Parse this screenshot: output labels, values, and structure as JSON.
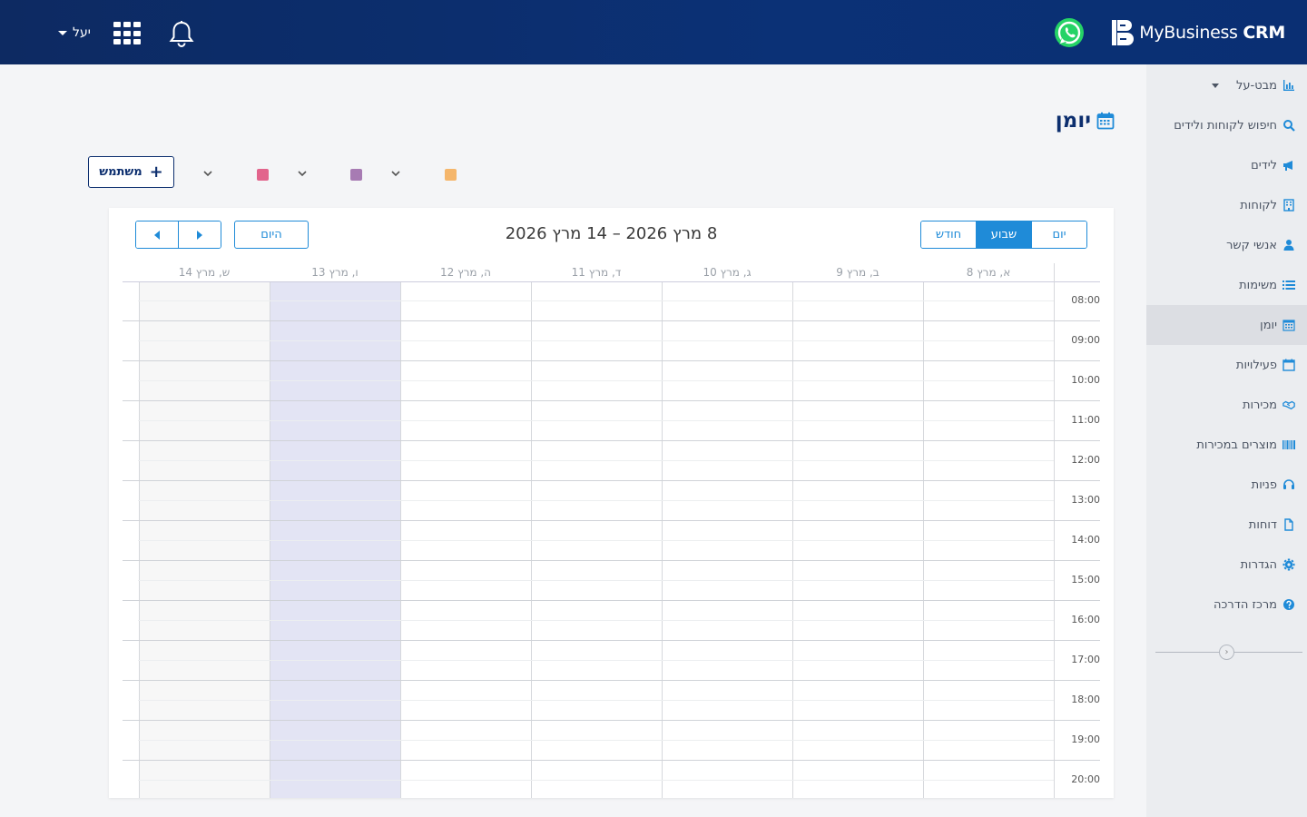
{
  "header": {
    "brand_main": "MyBusiness",
    "brand_bold": "CRM",
    "user_name": "יעל"
  },
  "sidebar": {
    "items": [
      {
        "label": "מבט-על",
        "icon": "bar-chart-icon"
      },
      {
        "label": "חיפוש לקוחות ולידים",
        "icon": "search-icon"
      },
      {
        "label": "לידים",
        "icon": "megaphone-icon"
      },
      {
        "label": "לקוחות",
        "icon": "building-icon"
      },
      {
        "label": "אנשי קשר",
        "icon": "user-icon"
      },
      {
        "label": "משימות",
        "icon": "list-icon"
      },
      {
        "label": "יומן",
        "icon": "calendar-icon",
        "active": true
      },
      {
        "label": "פעילויות",
        "icon": "calendar-check-icon"
      },
      {
        "label": "מכירות",
        "icon": "handshake-icon"
      },
      {
        "label": "מוצרים במכירות",
        "icon": "barcode-icon"
      },
      {
        "label": "פניות",
        "icon": "headset-icon"
      },
      {
        "label": "דוחות",
        "icon": "file-icon"
      },
      {
        "label": "הגדרות",
        "icon": "gear-icon"
      },
      {
        "label": "מרכז הדרכה",
        "icon": "question-circle-icon"
      }
    ]
  },
  "page": {
    "title": "יומן",
    "add_user_label": "משתמש"
  },
  "filters": {
    "swatches": [
      "#f5b66b",
      "#a77bb3",
      "#e2648c"
    ]
  },
  "calendar": {
    "range_title": "8 מרץ 2026 – 14 מרץ 2026",
    "today_label": "היום",
    "views": {
      "day": "יום",
      "week": "שבוע",
      "month": "חודש"
    },
    "active_view": "week",
    "days": [
      "א, מרץ 8",
      "ב, מרץ 9",
      "ג, מרץ 10",
      "ד, מרץ 11",
      "ה, מרץ 12",
      "ו, מרץ 13",
      "ש, מרץ 14"
    ],
    "today_index": 5,
    "hours": [
      "08:00",
      "09:00",
      "10:00",
      "11:00",
      "12:00",
      "13:00",
      "14:00",
      "15:00",
      "16:00",
      "17:00",
      "18:00",
      "19:00",
      "20:00"
    ]
  },
  "colors": {
    "brand_dark": "#0c2e6e",
    "accent": "#1f8bd8",
    "today_bg": "#e3e4f4"
  }
}
